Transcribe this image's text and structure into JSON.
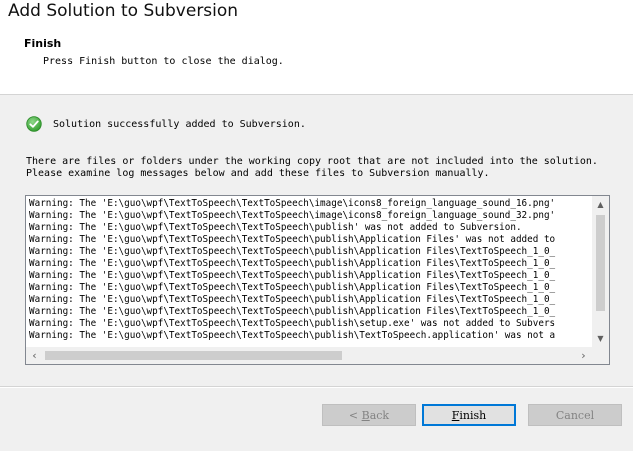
{
  "window": {
    "title": "Add Solution to Subversion"
  },
  "header": {
    "title": "Finish",
    "subtitle": "Press Finish button to close the dialog."
  },
  "status": {
    "icon": "check-circle-icon",
    "message": "Solution successfully added to Subversion."
  },
  "info": {
    "line1": "There are files or folders under the working copy root that are not included into the solution.",
    "line2": "Please examine log messages below and add these files to Subversion manually."
  },
  "log": {
    "lines": [
      "Warning: The 'E:\\guo\\wpf\\TextToSpeech\\TextToSpeech\\image\\icons8_foreign_language_sound_16.png'",
      "Warning: The 'E:\\guo\\wpf\\TextToSpeech\\TextToSpeech\\image\\icons8_foreign_language_sound_32.png'",
      "Warning: The 'E:\\guo\\wpf\\TextToSpeech\\TextToSpeech\\publish' was not added to Subversion.",
      "Warning: The 'E:\\guo\\wpf\\TextToSpeech\\TextToSpeech\\publish\\Application Files' was not added to",
      "Warning: The 'E:\\guo\\wpf\\TextToSpeech\\TextToSpeech\\publish\\Application Files\\TextToSpeech_1_0_",
      "Warning: The 'E:\\guo\\wpf\\TextToSpeech\\TextToSpeech\\publish\\Application Files\\TextToSpeech_1_0_",
      "Warning: The 'E:\\guo\\wpf\\TextToSpeech\\TextToSpeech\\publish\\Application Files\\TextToSpeech_1_0_",
      "Warning: The 'E:\\guo\\wpf\\TextToSpeech\\TextToSpeech\\publish\\Application Files\\TextToSpeech_1_0_",
      "Warning: The 'E:\\guo\\wpf\\TextToSpeech\\TextToSpeech\\publish\\Application Files\\TextToSpeech_1_0_",
      "Warning: The 'E:\\guo\\wpf\\TextToSpeech\\TextToSpeech\\publish\\Application Files\\TextToSpeech_1_0_",
      "Warning: The 'E:\\guo\\wpf\\TextToSpeech\\TextToSpeech\\publish\\setup.exe' was not added to Subvers",
      "Warning: The 'E:\\guo\\wpf\\TextToSpeech\\TextToSpeech\\publish\\TextToSpeech.application' was not a"
    ]
  },
  "buttons": {
    "back": {
      "prefix": "< ",
      "mnemonic": "B",
      "rest": "ack",
      "enabled": false
    },
    "finish": {
      "prefix": "",
      "mnemonic": "F",
      "rest": "inish",
      "enabled": true
    },
    "cancel": {
      "label": "Cancel",
      "enabled": false
    }
  },
  "colors": {
    "success_green": "#3fae3a",
    "default_button_border": "#0078d7"
  }
}
